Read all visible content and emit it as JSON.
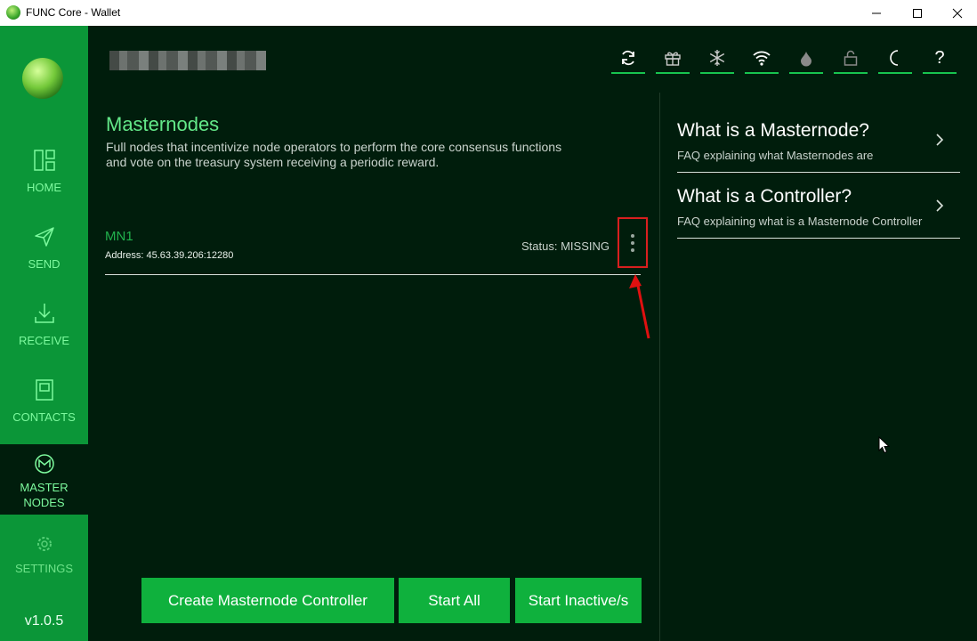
{
  "window": {
    "title": "FUNC Core - Wallet",
    "minimize": "—",
    "maximize": "☐",
    "close": "✕"
  },
  "sidebar": {
    "items": [
      {
        "label": "HOME",
        "icon": "home-icon"
      },
      {
        "label": "SEND",
        "icon": "send-icon"
      },
      {
        "label": "RECEIVE",
        "icon": "receive-icon"
      },
      {
        "label": "CONTACTS",
        "icon": "contacts-icon"
      },
      {
        "label_line1": "MASTER",
        "label_line2": "NODES",
        "icon": "masternodes-icon",
        "active": true
      },
      {
        "label": "SETTINGS",
        "icon": "settings-icon"
      }
    ],
    "version": "v1.0.5"
  },
  "header": {
    "icons": [
      "sync-icon",
      "gift-icon",
      "snowflake-icon",
      "wifi-icon",
      "tor-icon",
      "unlock-icon",
      "moon-icon",
      "help-icon"
    ]
  },
  "page": {
    "title": "Masternodes",
    "subtitle": "Full nodes that incentivize node operators to perform the core consensus functions and vote on the treasury system receiving a periodic reward."
  },
  "masternode": {
    "name": "MN1",
    "address": "Address: 45.63.39.206:12280",
    "status": "Status: MISSING"
  },
  "buttons": {
    "create": "Create Masternode Controller",
    "start_all": "Start All",
    "start_inactive": "Start Inactive/s"
  },
  "faq": [
    {
      "question": "What is a Masternode?",
      "answer": "FAQ explaining what Masternodes are"
    },
    {
      "question": "What is a Controller?",
      "answer": "FAQ explaining what is a Masternode Controller"
    }
  ],
  "colors": {
    "sidebar": "#0b9638",
    "background": "#001d0c",
    "accent": "#0fb13d",
    "highlight": "#d91f1f"
  }
}
